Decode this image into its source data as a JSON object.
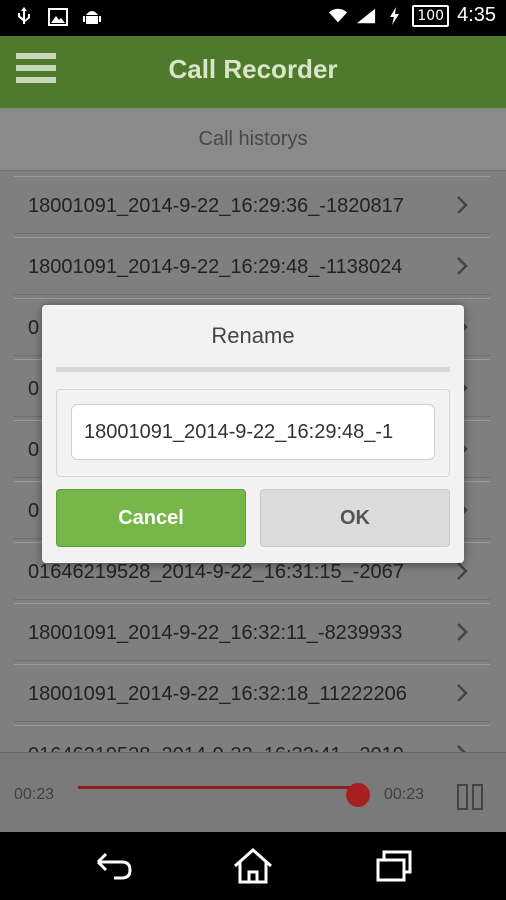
{
  "status_bar": {
    "time": "4:35",
    "battery": "100"
  },
  "app": {
    "title": "Call Recorder",
    "subheader": "Call historys"
  },
  "list": [
    "18001091_2014-9-22_16:29:36_-1820817",
    "18001091_2014-9-22_16:29:48_-1138024",
    "0",
    "0",
    "0",
    "0",
    "01646219528_2014-9-22_16:31:15_-2067",
    "18001091_2014-9-22_16:32:11_-8239933",
    "18001091_2014-9-22_16:32:18_11222206",
    "01646219528_2014-9-22_16:32:41_-2019"
  ],
  "player": {
    "elapsed": "00:23",
    "total": "00:23",
    "progress_percent": 96
  },
  "dialog": {
    "title": "Rename",
    "input_value": "18001091_2014-9-22_16:29:48_-1",
    "cancel_label": "Cancel",
    "ok_label": "OK"
  },
  "colors": {
    "app_bar": "#4f7a2c",
    "cancel_button": "#77b74a",
    "seek_track": "#8b1d1d"
  }
}
